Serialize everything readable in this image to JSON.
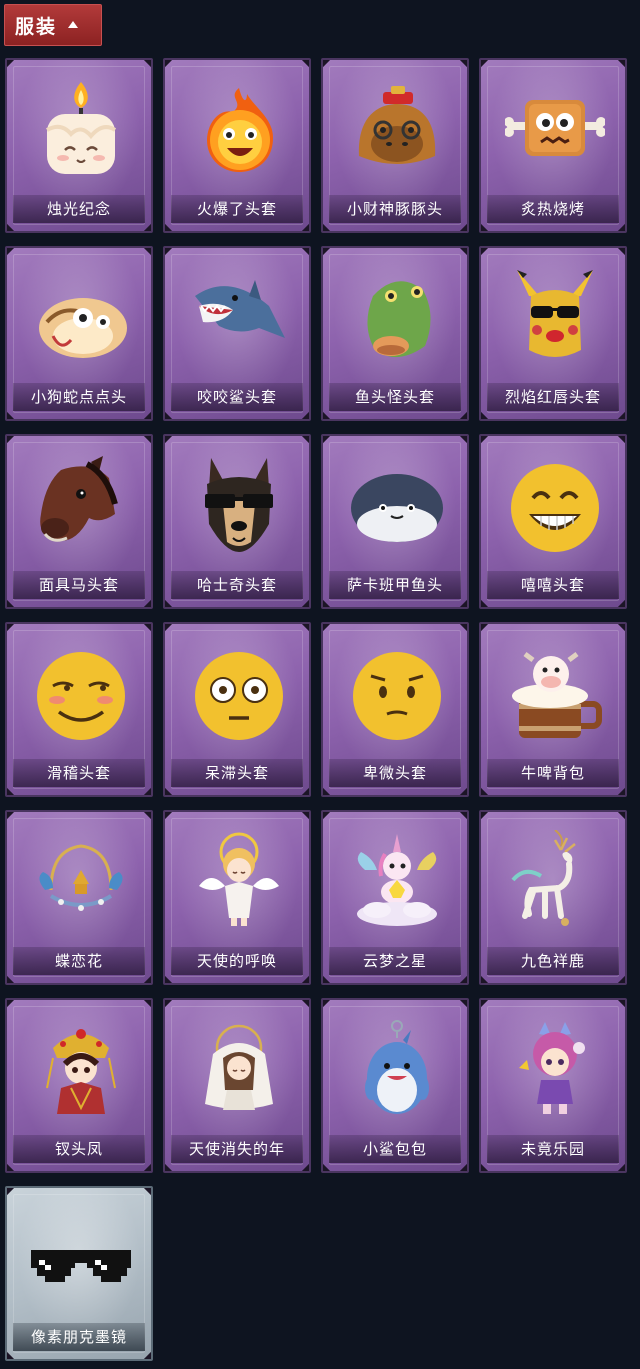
{
  "section": {
    "title": "服装",
    "toggle_icon": "chevron-up-icon"
  },
  "items": [
    {
      "label": "烛光纪念",
      "icon": "candle-head-icon",
      "bg": "purple"
    },
    {
      "label": "火爆了头套",
      "icon": "fire-head-icon",
      "bg": "purple"
    },
    {
      "label": "小财神豚豚头",
      "icon": "capybara-head-icon",
      "bg": "purple"
    },
    {
      "label": "炙热烧烤",
      "icon": "bbq-head-icon",
      "bg": "purple"
    },
    {
      "label": "小狗蛇点点头",
      "icon": "dog-snake-head-icon",
      "bg": "purple"
    },
    {
      "label": "咬咬鲨头套",
      "icon": "shark-head-icon",
      "bg": "purple"
    },
    {
      "label": "鱼头怪头套",
      "icon": "fish-monster-head-icon",
      "bg": "purple"
    },
    {
      "label": "烈焰红唇头套",
      "icon": "red-lips-head-icon",
      "bg": "purple"
    },
    {
      "label": "面具马头套",
      "icon": "horse-head-icon",
      "bg": "purple"
    },
    {
      "label": "哈士奇头套",
      "icon": "husky-head-icon",
      "bg": "purple"
    },
    {
      "label": "萨卡班甲鱼头",
      "icon": "sacabambaspis-head-icon",
      "bg": "purple"
    },
    {
      "label": "嘻嘻头套",
      "icon": "grin-emoji-head-icon",
      "bg": "purple"
    },
    {
      "label": "滑稽头套",
      "icon": "funny-emoji-head-icon",
      "bg": "purple"
    },
    {
      "label": "呆滞头套",
      "icon": "dazed-emoji-head-icon",
      "bg": "purple"
    },
    {
      "label": "卑微头套",
      "icon": "humble-emoji-head-icon",
      "bg": "purple"
    },
    {
      "label": "牛啤背包",
      "icon": "cow-beer-backpack-icon",
      "bg": "purple"
    },
    {
      "label": "蝶恋花",
      "icon": "butterfly-headdress-icon",
      "bg": "purple"
    },
    {
      "label": "天使的呼唤",
      "icon": "angel-doll-icon",
      "bg": "purple"
    },
    {
      "label": "云梦之星",
      "icon": "unicorn-cloud-icon",
      "bg": "purple"
    },
    {
      "label": "九色祥鹿",
      "icon": "deer-ornament-icon",
      "bg": "purple"
    },
    {
      "label": "钗头凤",
      "icon": "phoenix-crown-doll-icon",
      "bg": "purple"
    },
    {
      "label": "天使消失的年",
      "icon": "veiled-angel-doll-icon",
      "bg": "purple"
    },
    {
      "label": "小鲨包包",
      "icon": "shark-bag-icon",
      "bg": "purple"
    },
    {
      "label": "未竟乐园",
      "icon": "dream-park-doll-icon",
      "bg": "purple"
    },
    {
      "label": "像素朋克墨镜",
      "icon": "pixel-sunglasses-icon",
      "bg": "grey"
    }
  ],
  "colors": {
    "page_bg": "#0e1420",
    "tab_red": "#a52f2f",
    "card_purple": "#8d62ad",
    "card_grey": "#b2bec7"
  }
}
